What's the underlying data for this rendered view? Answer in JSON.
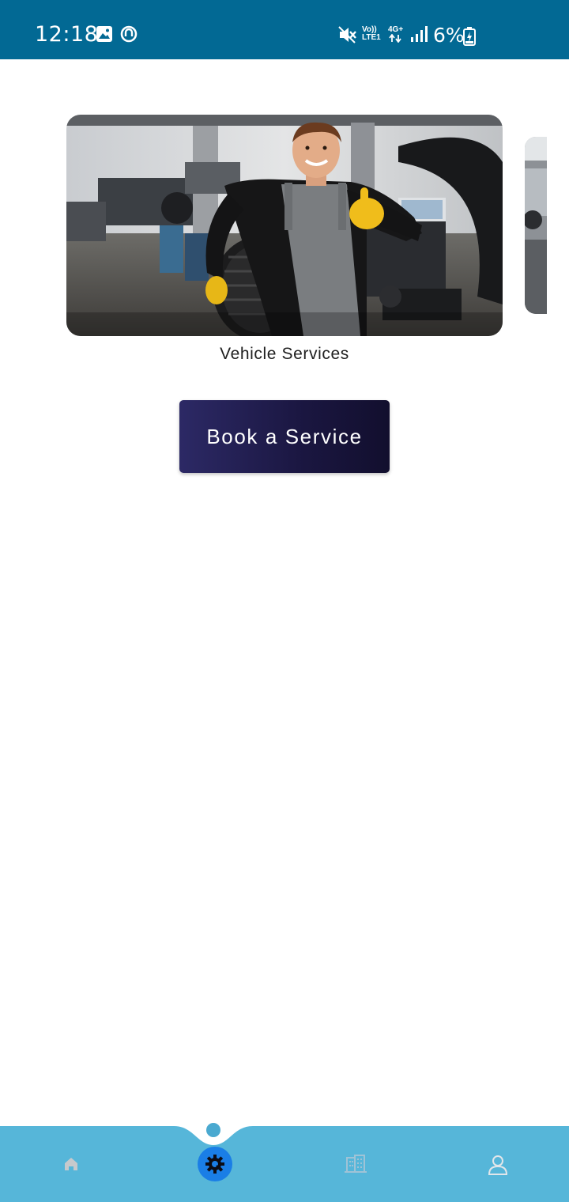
{
  "status_bar": {
    "time": "12:18",
    "network_left": "Vo))",
    "network_left_sub": "LTE1",
    "network_right": "4G+",
    "battery": "6%",
    "background": "#026994"
  },
  "carousel": {
    "caption": "Vehicle Services",
    "image_subject": "mechanic holding a tire giving thumbs up in a workshop"
  },
  "actions": {
    "book_label": "Book a Service"
  },
  "bottom_nav": {
    "background": "#56b6d9",
    "active_color": "#1a7ee6",
    "items": [
      {
        "icon": "home-icon",
        "active": false
      },
      {
        "icon": "gear-service-icon",
        "active": true
      },
      {
        "icon": "buildings-icon",
        "active": false
      },
      {
        "icon": "user-profile-icon",
        "active": false
      }
    ]
  }
}
